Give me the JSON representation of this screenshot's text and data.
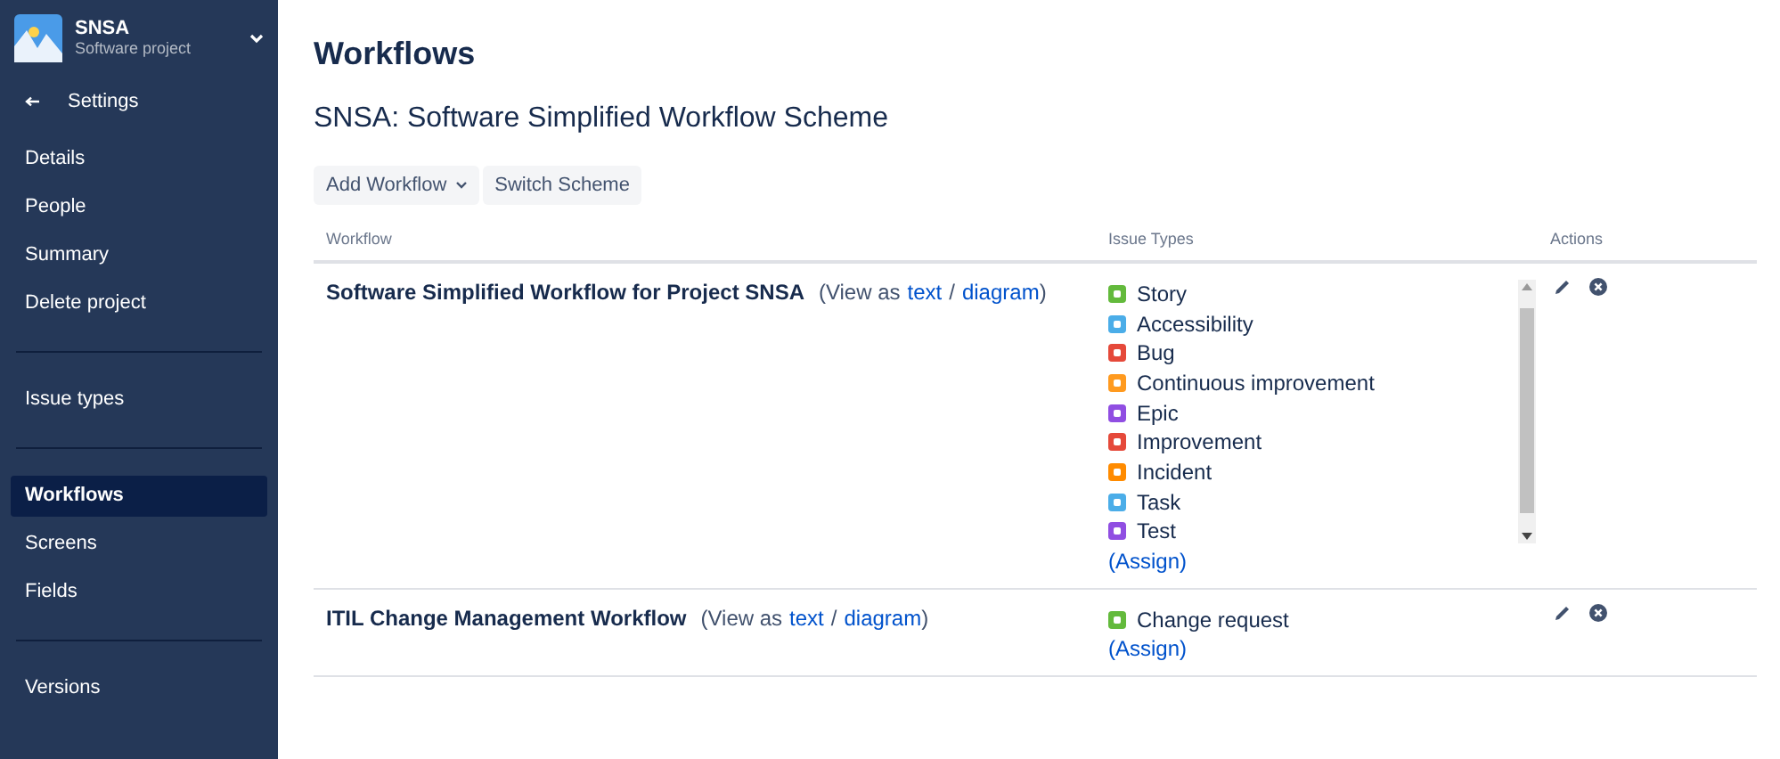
{
  "project": {
    "name": "SNSA",
    "type": "Software project"
  },
  "back": {
    "label": "Settings"
  },
  "sidebar": {
    "groups": [
      [
        {
          "label": "Details",
          "selected": false
        },
        {
          "label": "People",
          "selected": false
        },
        {
          "label": "Summary",
          "selected": false
        },
        {
          "label": "Delete project",
          "selected": false
        }
      ],
      [
        {
          "label": "Issue types",
          "selected": false
        }
      ],
      [
        {
          "label": "Workflows",
          "selected": true
        },
        {
          "label": "Screens",
          "selected": false
        },
        {
          "label": "Fields",
          "selected": false
        }
      ],
      [
        {
          "label": "Versions",
          "selected": false
        }
      ]
    ]
  },
  "page": {
    "title": "Workflows",
    "subtitle": "SNSA: Software Simplified Workflow Scheme"
  },
  "toolbar": [
    {
      "label": "Add Workflow",
      "kind": "dropdown"
    },
    {
      "label": "Switch Scheme",
      "kind": "button"
    }
  ],
  "table": {
    "columns": [
      "Workflow",
      "Issue Types",
      "Actions"
    ],
    "rows": [
      {
        "name": "Software Simplified Workflow for Project SNSA",
        "view_prefix": "(View as",
        "text_link": "text",
        "separator": "/",
        "diagram_link": "diagram",
        "view_suffix": ")",
        "scrollable": true,
        "assign": [
          "(",
          "Assign",
          ")"
        ],
        "issue_types": [
          {
            "label": "Story",
            "color": "#63ba3c"
          },
          {
            "label": "Accessibility",
            "color": "#4bade8"
          },
          {
            "label": "Bug",
            "color": "#e5493a"
          },
          {
            "label": "Continuous improvement",
            "color": "#ff9a1f"
          },
          {
            "label": "Epic",
            "color": "#904ee2"
          },
          {
            "label": "Improvement",
            "color": "#e5493a"
          },
          {
            "label": "Incident",
            "color": "#ff8b00"
          },
          {
            "label": "Task",
            "color": "#4bade8"
          },
          {
            "label": "Test",
            "color": "#904ee2"
          }
        ]
      },
      {
        "name": "ITIL Change Management Workflow",
        "view_prefix": "(View as",
        "text_link": "text",
        "separator": "/",
        "diagram_link": "diagram",
        "view_suffix": ")",
        "scrollable": false,
        "assign": [
          "(",
          "Assign",
          ")"
        ],
        "issue_types": [
          {
            "label": "Change request",
            "color": "#63ba3c"
          }
        ]
      }
    ]
  }
}
